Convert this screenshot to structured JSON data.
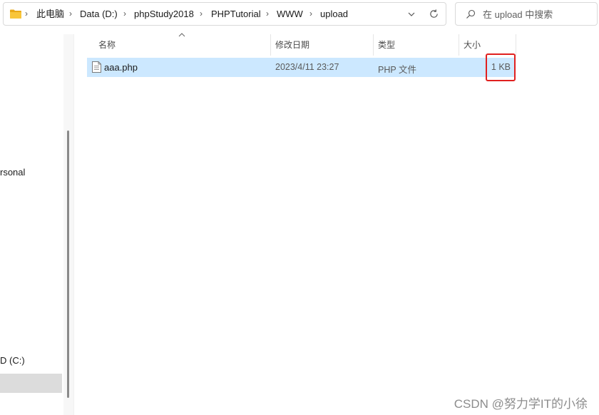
{
  "address_bar": {
    "breadcrumbs": [
      "此电脑",
      "Data (D:)",
      "phpStudy2018",
      "PHPTutorial",
      "WWW",
      "upload"
    ],
    "separator": "›"
  },
  "search": {
    "placeholder": "在 upload 中搜索"
  },
  "nav_pane": {
    "items": [
      {
        "label": "rsonal"
      },
      {
        "label": "D (C:)"
      }
    ]
  },
  "columns": [
    {
      "label": "名称"
    },
    {
      "label": "修改日期"
    },
    {
      "label": "类型"
    },
    {
      "label": "大小"
    }
  ],
  "files": [
    {
      "name": "aaa.php",
      "modified": "2023/4/11 23:27",
      "type": "PHP 文件",
      "size": "1 KB"
    }
  ],
  "watermark": "CSDN @努力学IT的小徐",
  "colors": {
    "selection": "#cce8ff",
    "highlight": "#e0201f",
    "folder": "#f8c53a"
  },
  "icons": [
    "folder-icon",
    "chevron-down-icon",
    "refresh-icon",
    "search-icon",
    "php-file-icon",
    "sort-ascending-icon"
  ]
}
